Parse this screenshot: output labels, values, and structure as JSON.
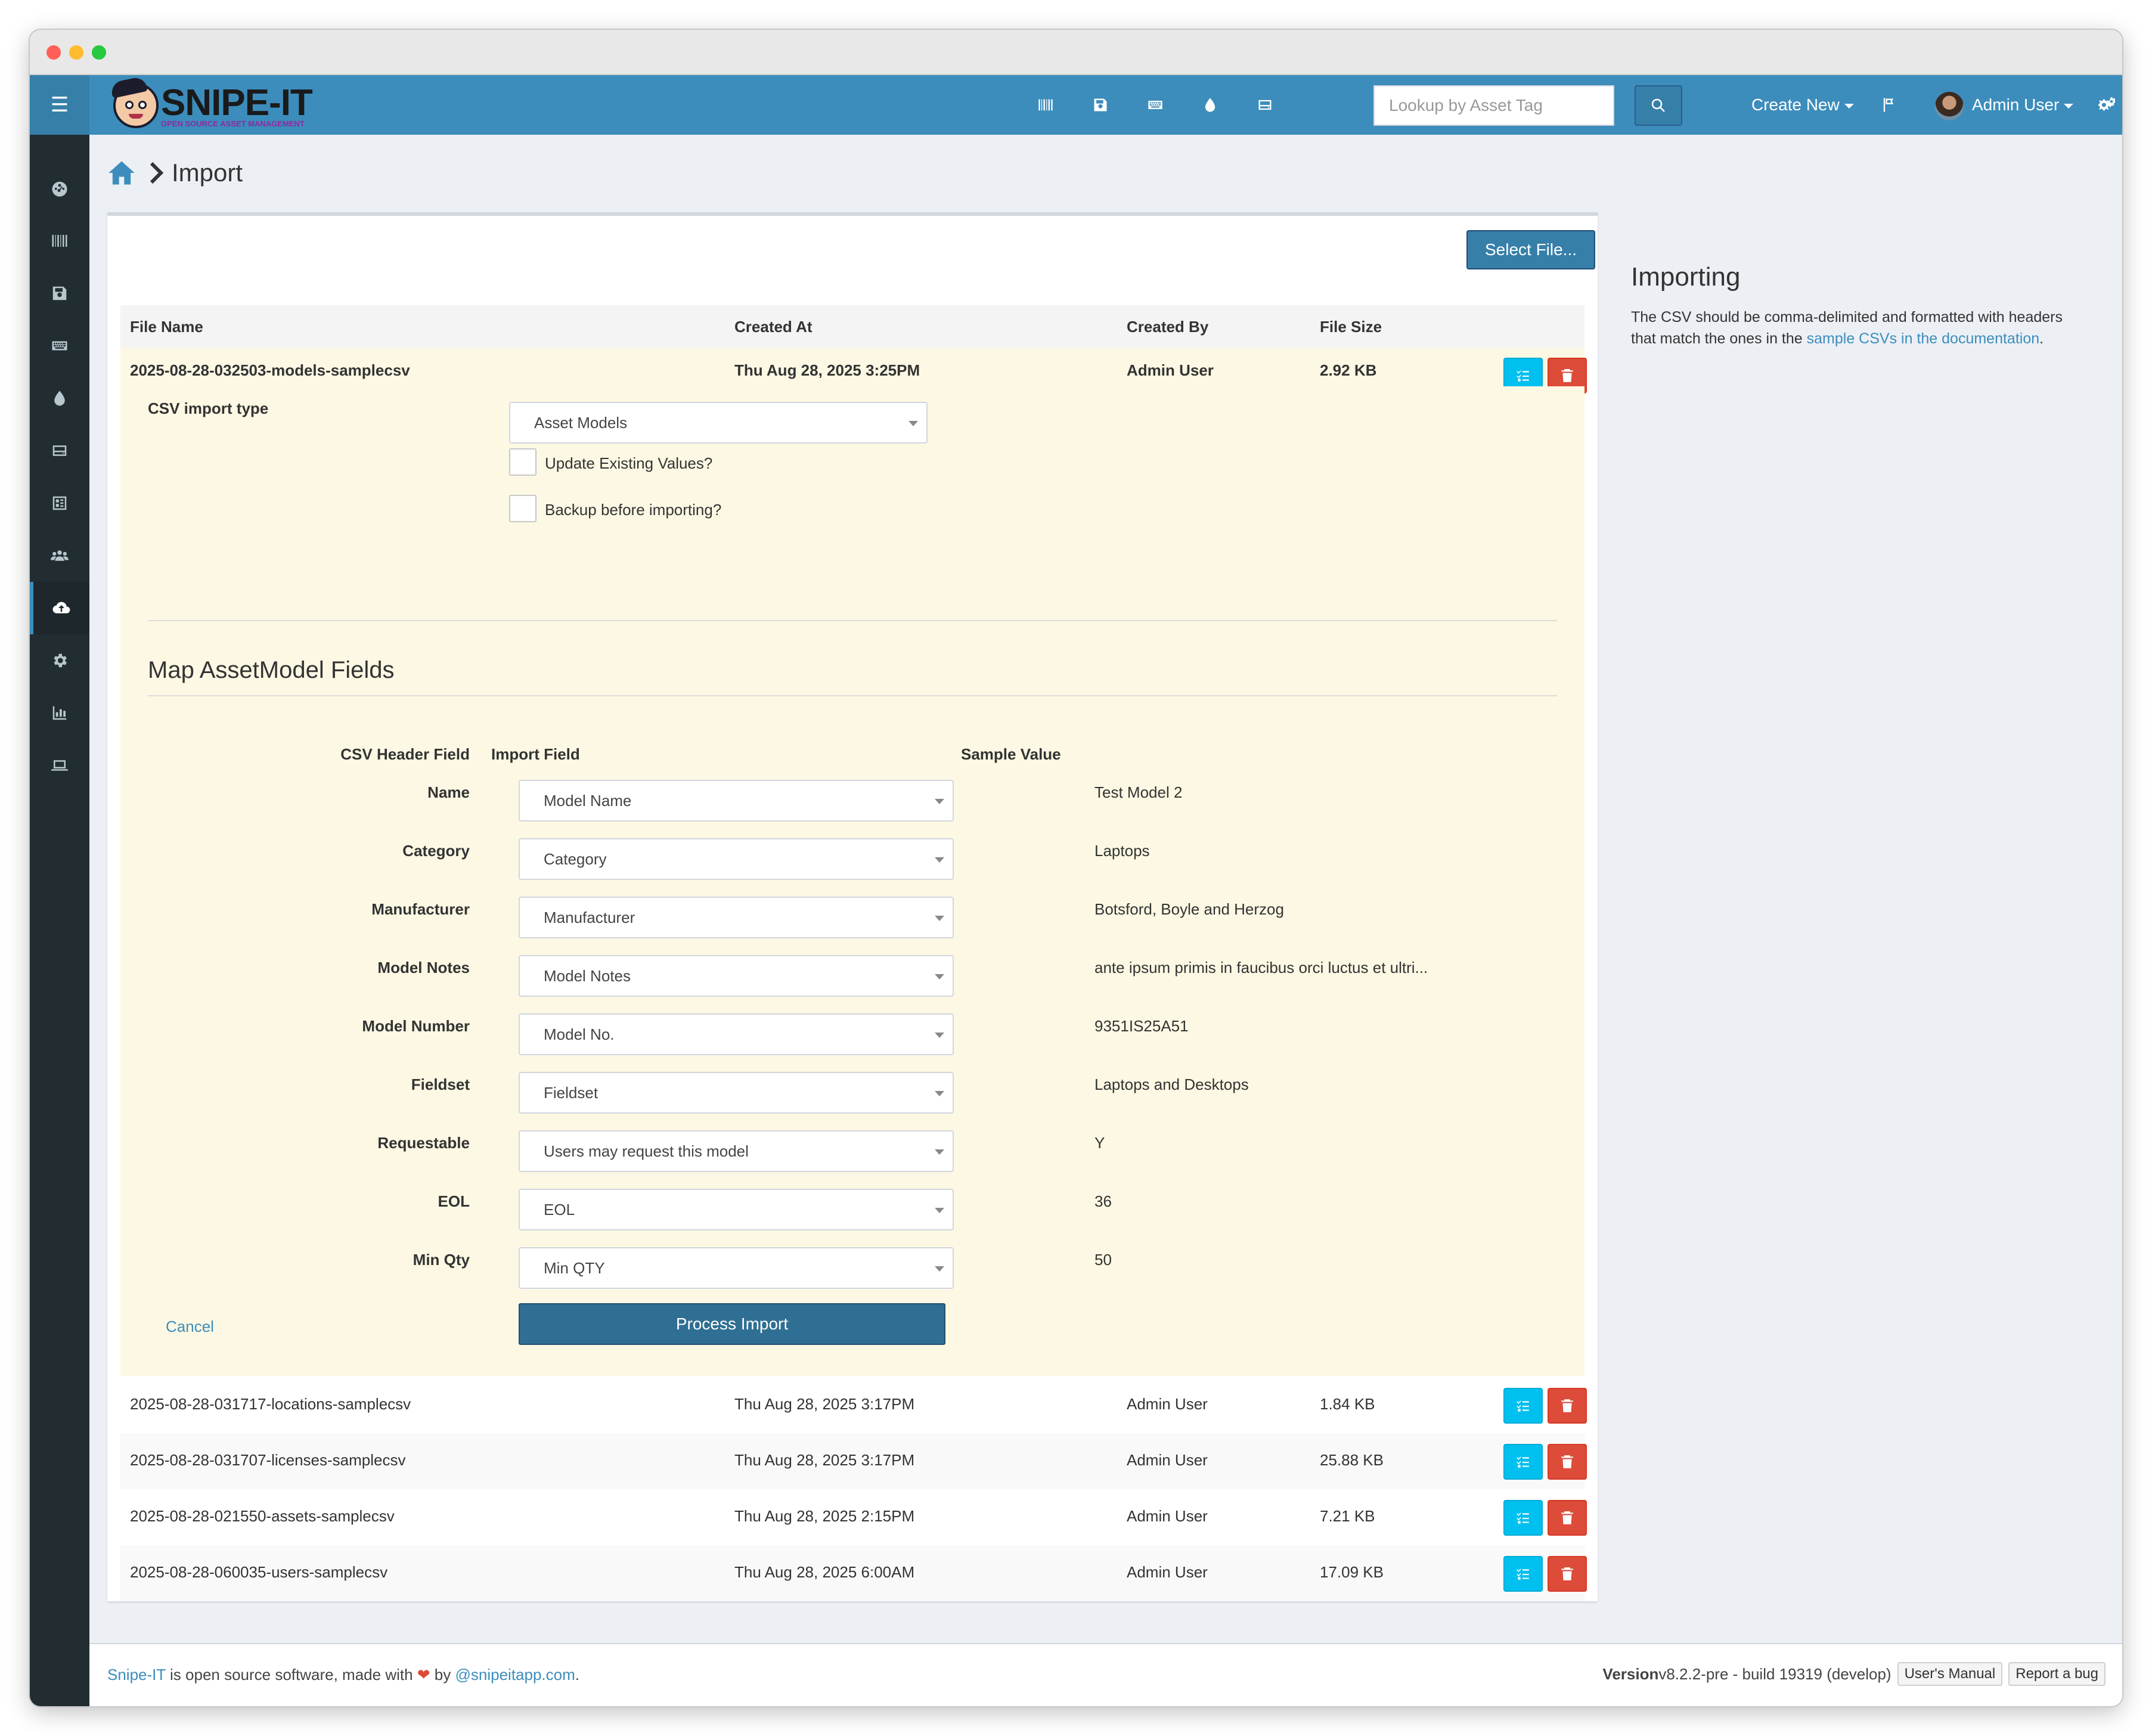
{
  "colors": {
    "brand": "#3c8dbc",
    "sidebar": "#222d32",
    "info": "#00c0ef",
    "danger": "#dd4b39",
    "highlight": "#fcf8e3"
  },
  "topnav": {
    "logo_text": "SNIPE-IT",
    "logo_subtitle": "OPEN SOURCE ASSET MANAGEMENT",
    "search_placeholder": "Lookup by Asset Tag",
    "create_new": "Create New",
    "user_name": "Admin User",
    "icons": [
      "barcode-icon",
      "save-icon",
      "keyboard-icon",
      "tint-icon",
      "hdd-icon",
      "search-icon",
      "flag-icon",
      "cogs-icon"
    ]
  },
  "sidebar": {
    "items": [
      "dashboard-icon",
      "barcode-icon",
      "save-icon",
      "keyboard-icon",
      "tint-icon",
      "hdd-icon",
      "components-icon",
      "users-icon",
      "cloud-upload-icon",
      "settings-icon",
      "reports-icon",
      "laptop-icon"
    ],
    "active": "cloud-upload-icon"
  },
  "breadcrumb": {
    "current": "Import"
  },
  "import": {
    "select_file": "Select File...",
    "columns": {
      "file_name": "File Name",
      "created_at": "Created At",
      "created_by": "Created By",
      "file_size": "File Size"
    },
    "active_file": {
      "name": "2025-08-28-032503-models-samplecsv",
      "created_at": "Thu Aug 28, 2025 3:25PM",
      "created_by": "Admin User",
      "size": "2.92 KB"
    },
    "csv_type_label": "CSV import type",
    "csv_type_value": "Asset Models",
    "update_existing": "Update Existing Values?",
    "backup": "Backup before importing?",
    "map_title": "Map AssetModel Fields",
    "map_headers": {
      "csv_header": "CSV Header Field",
      "import_field": "Import Field",
      "sample": "Sample Value"
    },
    "fields": [
      {
        "header": "Name",
        "field": "Model Name",
        "sample": "Test Model 2"
      },
      {
        "header": "Category",
        "field": "Category",
        "sample": "Laptops"
      },
      {
        "header": "Manufacturer",
        "field": "Manufacturer",
        "sample": "Botsford, Boyle and Herzog"
      },
      {
        "header": "Model Notes",
        "field": "Model Notes",
        "sample": "ante ipsum primis in faucibus orci luctus et ultri..."
      },
      {
        "header": "Model Number",
        "field": "Model No.",
        "sample": "9351IS25A51"
      },
      {
        "header": "Fieldset",
        "field": "Fieldset",
        "sample": "Laptops and Desktops"
      },
      {
        "header": "Requestable",
        "field": "Users may request this model",
        "sample": "Y"
      },
      {
        "header": "EOL",
        "field": "EOL",
        "sample": "36"
      },
      {
        "header": "Min Qty",
        "field": "Min QTY",
        "sample": "50"
      }
    ],
    "cancel": "Cancel",
    "process": "Process Import",
    "files": [
      {
        "name": "2025-08-28-031717-locations-samplecsv",
        "created_at": "Thu Aug 28, 2025 3:17PM",
        "created_by": "Admin User",
        "size": "1.84 KB"
      },
      {
        "name": "2025-08-28-031707-licenses-samplecsv",
        "created_at": "Thu Aug 28, 2025 3:17PM",
        "created_by": "Admin User",
        "size": "25.88 KB"
      },
      {
        "name": "2025-08-28-021550-assets-samplecsv",
        "created_at": "Thu Aug 28, 2025 2:15PM",
        "created_by": "Admin User",
        "size": "7.21 KB"
      },
      {
        "name": "2025-08-28-060035-users-samplecsv",
        "created_at": "Thu Aug 28, 2025 6:00AM",
        "created_by": "Admin User",
        "size": "17.09 KB"
      }
    ]
  },
  "help": {
    "title": "Importing",
    "text_before": "The CSV should be comma-delimited and formatted with headers that match the ones in the ",
    "link": "sample CSVs in the documentation",
    "text_after": "."
  },
  "footer": {
    "brand": "Snipe-IT",
    "text1": " is open source software, made with ",
    "text2": " by ",
    "handle": "@snipeitapp.com",
    "text3": ".",
    "version_label": "Version",
    "version": " v8.2.2-pre - build 19319 (develop)",
    "manual": "User's Manual",
    "bug": "Report a bug"
  }
}
